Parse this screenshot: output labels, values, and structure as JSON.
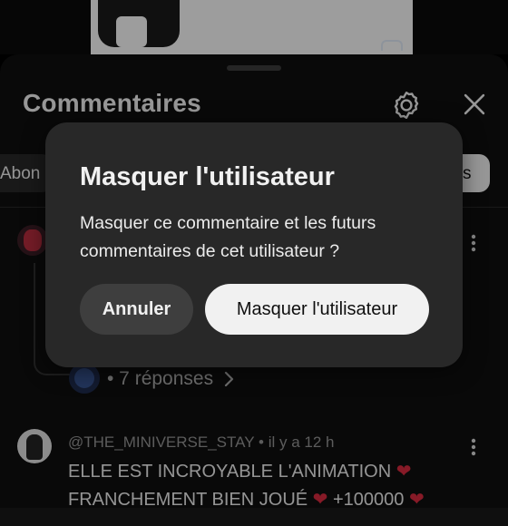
{
  "sheet": {
    "title": "Commentaires",
    "icons": {
      "settings": "gear-icon",
      "close": "close-icon"
    }
  },
  "filters": {
    "left_chip": "Abon",
    "right_chip": "s"
  },
  "comments": [
    {
      "replies_label": "• 7 réponses",
      "icons": {
        "more": "more-vert-icon",
        "chevron": "chevron-right-icon"
      }
    },
    {
      "author": "@THE_MINIVERSE_STAY",
      "time": "il y a 12 h",
      "line1": "ELLE EST INCROYABLE L'ANIMATION",
      "line2a": "FRANCHEMENT BIEN JOUÉ",
      "line2b": "+100000",
      "heart": "❤"
    }
  ],
  "dialog": {
    "title": "Masquer l'utilisateur",
    "message": "Masquer ce commentaire et les futurs commentaires de cet utilisateur ?",
    "cancel_label": "Annuler",
    "confirm_label": "Masquer l'utilisateur"
  },
  "colors": {
    "sheet_bg": "#0f0f0f",
    "dialog_bg": "#282828",
    "heart": "#d0293d",
    "confirm_bg": "#f1f1f1"
  }
}
